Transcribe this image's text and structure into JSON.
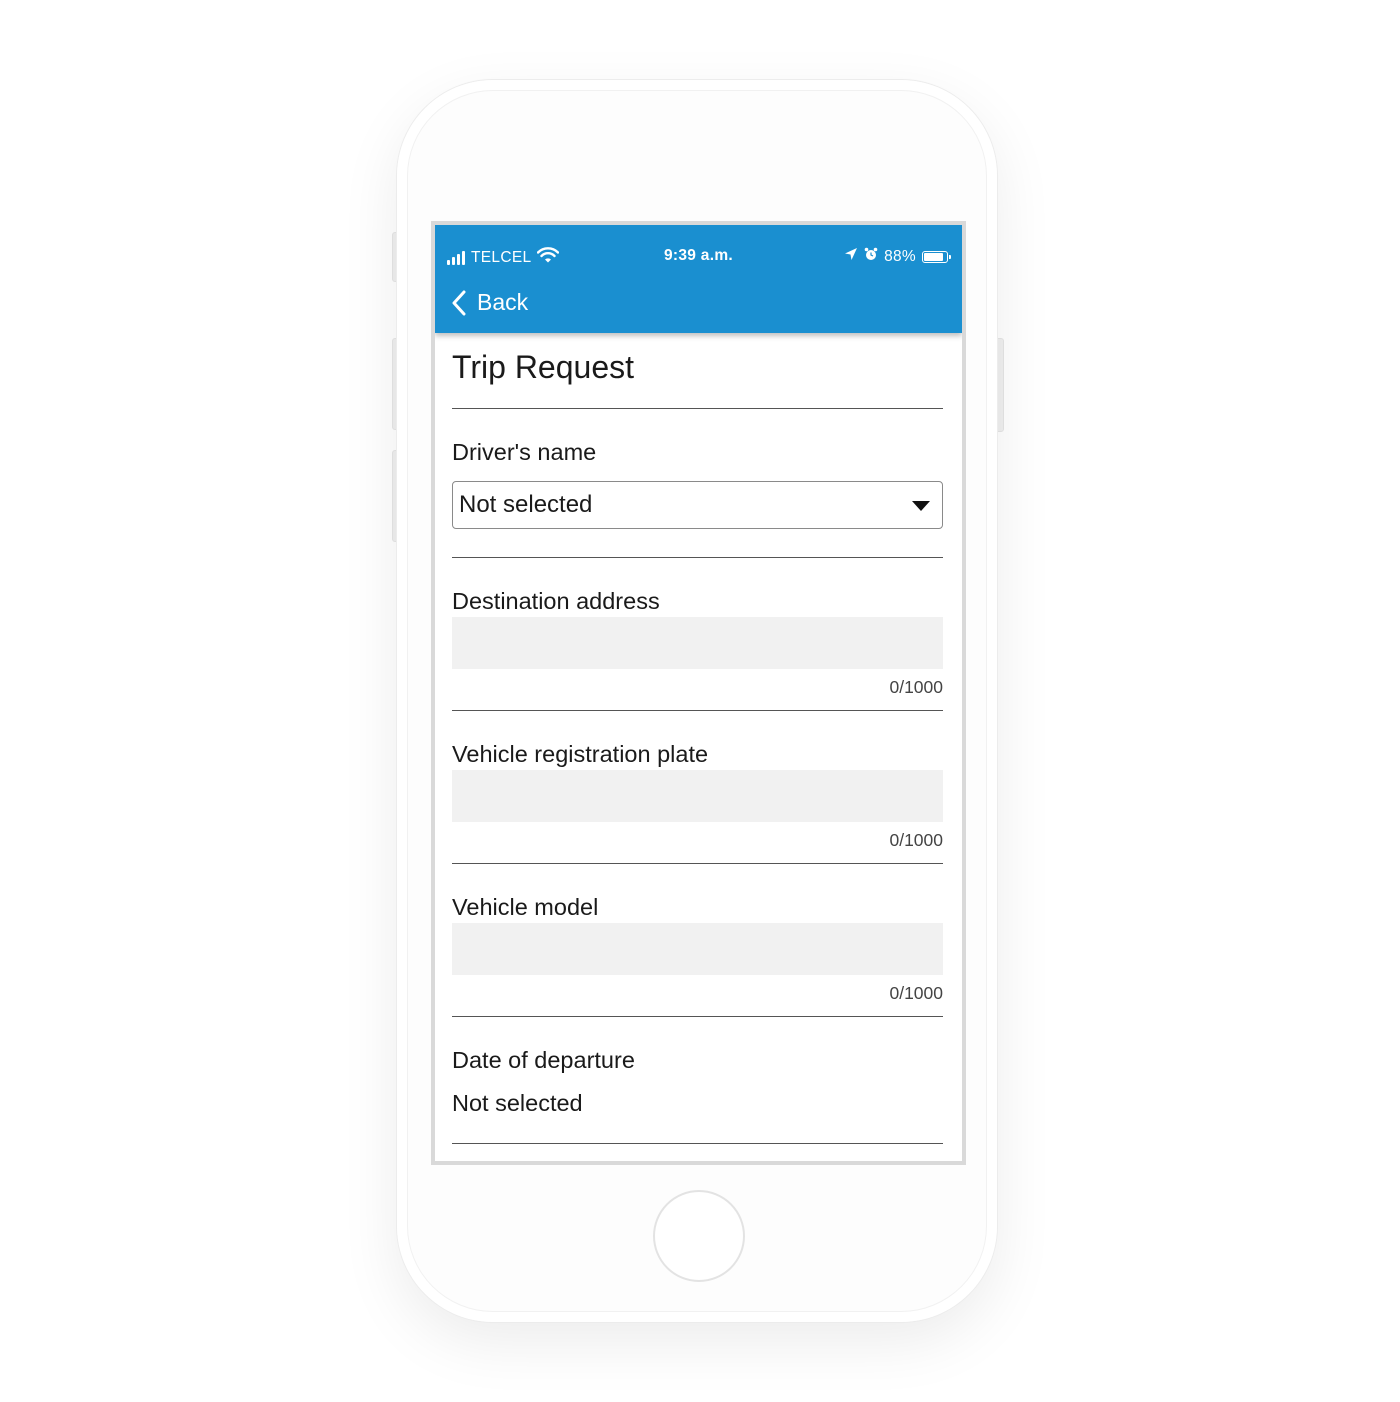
{
  "status_bar": {
    "carrier": "TELCEL",
    "time": "9:39 a.m.",
    "battery_text": "88%",
    "battery_level": 0.88
  },
  "nav": {
    "back_label": "Back"
  },
  "page": {
    "title": "Trip Request"
  },
  "form": {
    "driver_name": {
      "label": "Driver's name",
      "value": "Not selected"
    },
    "destination_address": {
      "label": "Destination address",
      "value": "",
      "counter": "0/1000"
    },
    "vehicle_plate": {
      "label": "Vehicle registration plate",
      "value": "",
      "counter": "0/1000"
    },
    "vehicle_model": {
      "label": "Vehicle model",
      "value": "",
      "counter": "0/1000"
    },
    "departure_date": {
      "label": "Date of departure",
      "value": "Not selected"
    }
  },
  "colors": {
    "header_background": "#1a8fd0",
    "input_background": "#f1f1f1",
    "divider": "#555555"
  },
  "icons": {
    "signal": "cellular-signal-icon",
    "wifi": "wifi-icon",
    "location": "location-arrow-icon",
    "alarm": "alarm-clock-icon",
    "battery": "battery-icon",
    "back": "chevron-left-icon",
    "dropdown": "caret-down-icon",
    "home": "home-button"
  }
}
